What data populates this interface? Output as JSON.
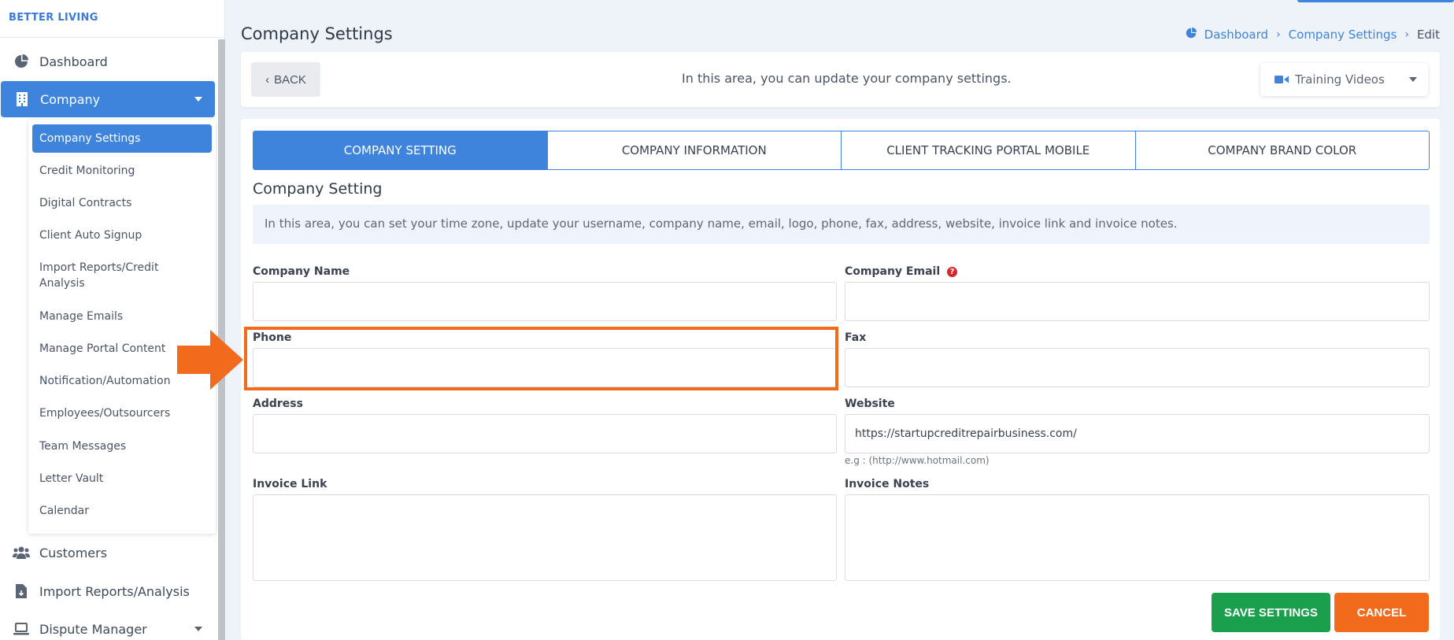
{
  "brand": "BETTER LIVING",
  "sidebar": {
    "items": [
      {
        "label": "Dashboard",
        "icon": "pie-chart-icon"
      },
      {
        "label": "Company",
        "icon": "building-icon"
      },
      {
        "label": "Customers",
        "icon": "users-icon"
      },
      {
        "label": "Import Reports/Analysis",
        "icon": "file-import-icon"
      },
      {
        "label": "Dispute Manager",
        "icon": "laptop-icon"
      }
    ],
    "submenu": [
      "Company Settings",
      "Credit Monitoring",
      "Digital Contracts",
      "Client Auto Signup",
      "Import Reports/Credit Analysis",
      "Manage Emails",
      "Manage Portal Content",
      "Notification/Automation",
      "Employees/Outsourcers",
      "Team Messages",
      "Letter Vault",
      "Calendar"
    ]
  },
  "header": {
    "title": "Company Settings",
    "breadcrumb": [
      "Dashboard",
      "Company Settings",
      "Edit"
    ]
  },
  "top_card": {
    "back_label": "BACK",
    "description": "In this area, you can update your company settings.",
    "training_label": "Training Videos"
  },
  "tabs": [
    "COMPANY SETTING",
    "COMPANY INFORMATION",
    "CLIENT TRACKING PORTAL MOBILE",
    "COMPANY BRAND COLOR"
  ],
  "section": {
    "title": "Company Setting",
    "info": "In this area, you can set your time zone, update your username, company name, email, logo, phone, fax, address, website, invoice link and invoice notes."
  },
  "form": {
    "company_name_label": "Company Name",
    "company_name_value": "",
    "company_email_label": "Company Email",
    "company_email_value": "",
    "phone_label": "Phone",
    "phone_value": "",
    "fax_label": "Fax",
    "fax_value": "",
    "address_label": "Address",
    "address_value": "",
    "website_label": "Website",
    "website_value": "https://startupcreditrepairbusiness.com/",
    "website_hint": "e.g : (http://www.hotmail.com)",
    "invoice_link_label": "Invoice Link",
    "invoice_link_value": "",
    "invoice_notes_label": "Invoice Notes",
    "invoice_notes_value": ""
  },
  "buttons": {
    "save": "SAVE SETTINGS",
    "cancel": "CANCEL"
  },
  "colors": {
    "primary": "#3f84dc",
    "save": "#1aa04c",
    "cancel": "#f26a1b",
    "highlight": "#f26a1b"
  }
}
